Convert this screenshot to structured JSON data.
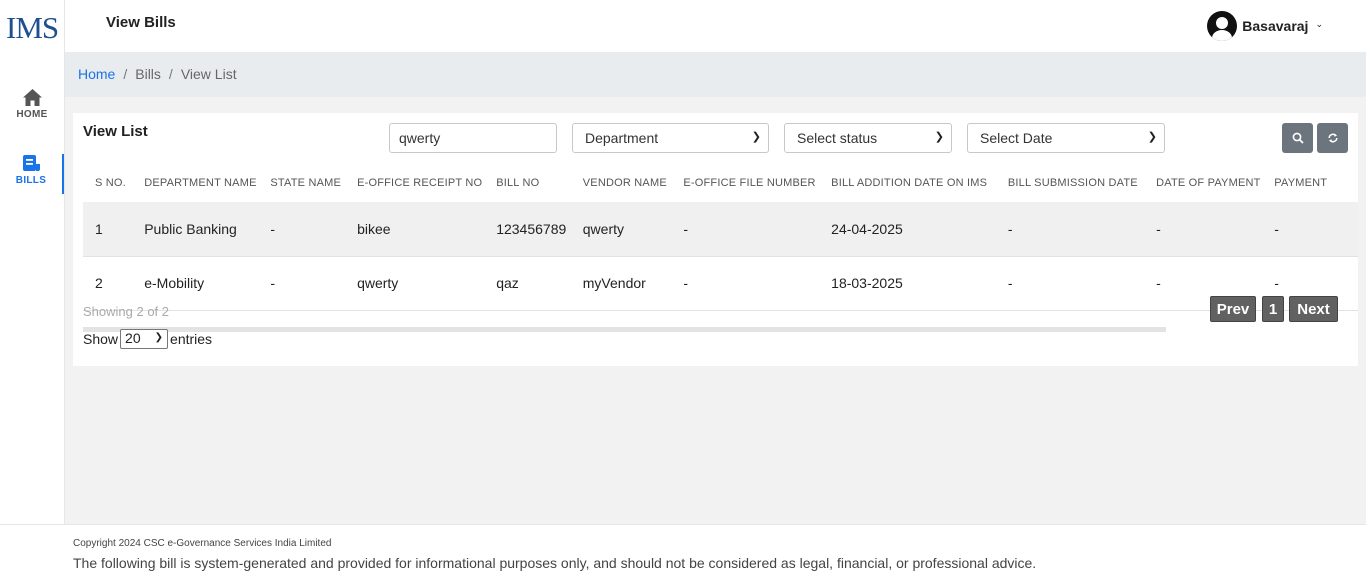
{
  "app": {
    "logo": "IMS"
  },
  "sidebar": {
    "items": [
      {
        "label": "HOME",
        "icon": "home-icon"
      },
      {
        "label": "BILLS",
        "icon": "bills-icon",
        "active": true
      }
    ]
  },
  "header": {
    "title": "View Bills",
    "user_name": "Basavaraj"
  },
  "breadcrumb": [
    "Home",
    "Bills",
    "View List"
  ],
  "card": {
    "title": "View List",
    "search_value": "qwerty",
    "department_select": "Department",
    "status_select": "Select status",
    "date_select": "Select Date"
  },
  "table": {
    "columns": [
      "S NO.",
      "DEPARTMENT NAME",
      "STATE NAME",
      "E-OFFICE RECEIPT NO",
      "BILL NO",
      "VENDOR NAME",
      "E-OFFICE FILE NUMBER",
      "BILL ADDITION DATE ON IMS",
      "BILL SUBMISSION DATE",
      "DATE OF PAYMENT",
      "PAYMENT"
    ],
    "rows": [
      [
        "1",
        "Public Banking",
        "-",
        "bikee",
        "123456789",
        "qwerty",
        "-",
        "24-04-2025",
        "-",
        "-",
        "-"
      ],
      [
        "2",
        "e-Mobility",
        "-",
        "qwerty",
        "qaz",
        "myVendor",
        "-",
        "18-03-2025",
        "-",
        "-",
        "-"
      ]
    ]
  },
  "pagination": {
    "showing": "Showing 2 of 2",
    "show_label": "Show",
    "entries_value": "20",
    "entries_label": "entries",
    "prev": "Prev",
    "page": "1",
    "next": "Next"
  },
  "footer": {
    "copyright": "Copyright 2024 CSC e-Governance Services India Limited",
    "disclaimer": "The following bill is system-generated and provided for informational purposes only, and should not be considered as legal, financial, or professional advice."
  },
  "colors": {
    "accent": "#1a73e8",
    "logo": "#1d4f91",
    "button": "#6c757d"
  }
}
